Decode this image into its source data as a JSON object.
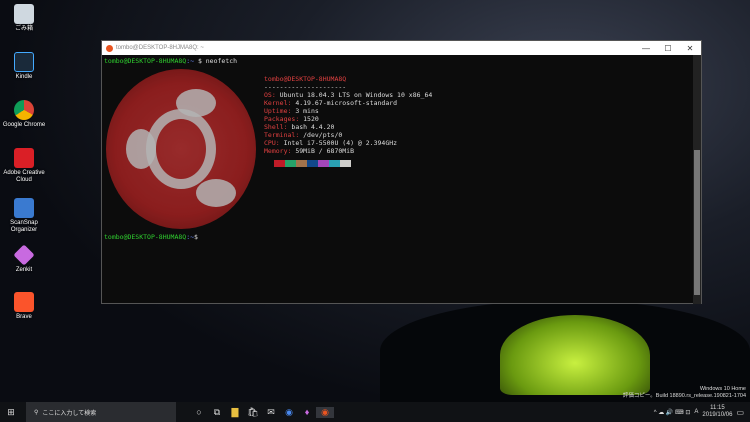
{
  "desktop": {
    "icons": [
      {
        "label": "ごみ箱",
        "color": "#cfd8e0"
      },
      {
        "label": "Kindle",
        "color": "#1a2a3a"
      },
      {
        "label": "Google Chrome",
        "color": "#4a8af0"
      },
      {
        "label": "Adobe Creative Cloud",
        "color": "#da1f26"
      },
      {
        "label": "ScanSnap Organizer",
        "color": "#3a7ad0"
      },
      {
        "label": "Zenkit",
        "color": "#c86ae0"
      },
      {
        "label": "Brave",
        "color": "#fb542b"
      }
    ],
    "watermark": {
      "line1": "Windows 10 Home",
      "line2": "評価コピー。Build 18890.rs_release.190821-1704"
    }
  },
  "terminal": {
    "title": "tombo@DESKTOP-8HJMA8Q: ~",
    "prompt_user": "tombo@DESKTOP-8HUMA8Q",
    "prompt_path": ":~",
    "command": "$ neofetch",
    "final_prompt": "$",
    "header": "tombo@DESKTOP-8HUMA8Q",
    "separator": "---------------------",
    "info": [
      {
        "k": "OS",
        "v": "Ubuntu 18.04.3 LTS on Windows 10 x86_64"
      },
      {
        "k": "Kernel",
        "v": "4.19.67-microsoft-standard"
      },
      {
        "k": "Uptime",
        "v": "3 mins"
      },
      {
        "k": "Packages",
        "v": "1520"
      },
      {
        "k": "Shell",
        "v": "bash 4.4.20"
      },
      {
        "k": "Terminal",
        "v": "/dev/pts/0"
      },
      {
        "k": "CPU",
        "v": "Intel i7-5500U (4) @ 2.394GHz"
      },
      {
        "k": "Memory",
        "v": "59MiB / 6870MiB"
      }
    ],
    "palette": [
      "#c01c28",
      "#26a269",
      "#a2734c",
      "#12488b",
      "#a347ba",
      "#2aa1b3",
      "#d0cfcc"
    ],
    "controls": {
      "min": "—",
      "max": "☐",
      "close": "✕"
    }
  },
  "taskbar": {
    "search_placeholder": "ここに入力して検索",
    "time": "11:15",
    "date": "2019/10/06",
    "ime": "A",
    "lang_icons": "^ ☁ 🔊 ⌨ ⊡"
  }
}
